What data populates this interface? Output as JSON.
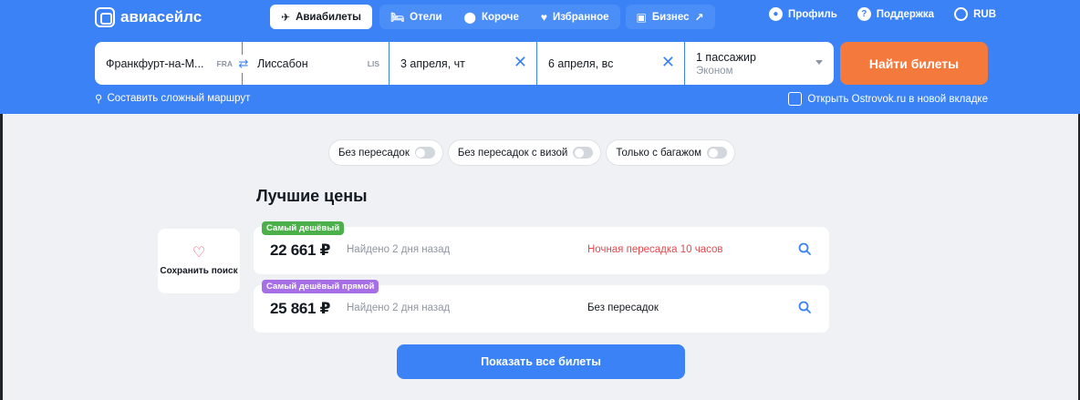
{
  "brand": {
    "name": "авиасейлс"
  },
  "nav": {
    "tabs": [
      {
        "label": "Авиабилеты",
        "icon": "plane-icon"
      },
      {
        "label": "Отели",
        "icon": "bed-icon"
      },
      {
        "label": "Короче",
        "icon": "pin-icon"
      },
      {
        "label": "Избранное",
        "icon": "heart-icon"
      },
      {
        "label": "Бизнес",
        "icon": "briefcase-icon",
        "suffix": "↗"
      }
    ]
  },
  "top_right": {
    "profile": "Профиль",
    "support": "Поддержка",
    "currency": "RUB"
  },
  "search": {
    "from": "Франкфурт-на-М...",
    "from_code": "FRA",
    "to": "Лиссабон",
    "to_code": "LIS",
    "depart": "3 апреля, чт",
    "return": "6 апреля, вс",
    "passengers": "1 пассажир",
    "cabin": "Эконом",
    "find_button": "Найти билеты"
  },
  "links": {
    "complex_route": "Составить сложный маршрут",
    "ostrovok": "Открыть Ostrovok.ru в новой вкладке"
  },
  "filters": [
    {
      "label": "Без пересадок"
    },
    {
      "label": "Без пересадок с визой"
    },
    {
      "label": "Только с багажом"
    }
  ],
  "best": {
    "title": "Лучшие цены",
    "save_search": "Сохранить поиск",
    "rows": [
      {
        "badge": "Самый дешёвый",
        "price": "22 661 ₽",
        "found": "Найдено 2 дня назад",
        "transfer": "Ночная пересадка 10 часов"
      },
      {
        "badge": "Самый дешёвый прямой",
        "price": "25 861 ₽",
        "found": "Найдено 2 дня назад",
        "transfer": "Без пересадок"
      }
    ],
    "show_all": "Показать все билеты"
  },
  "colors": {
    "brand_blue": "#3b82f6",
    "accent_orange": "#f37a3c",
    "badge_green": "#4cb04a",
    "badge_purple": "#a66fe6",
    "warning_red": "#e5484d"
  }
}
